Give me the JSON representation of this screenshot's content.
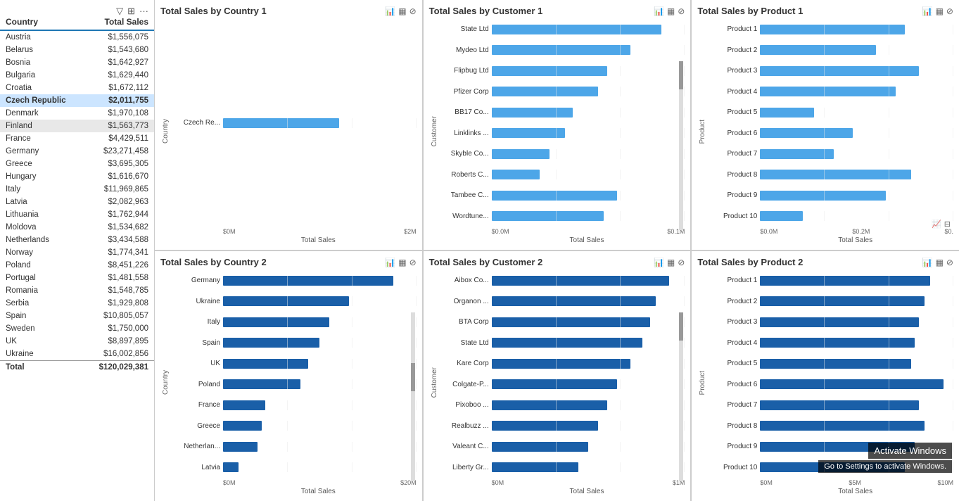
{
  "leftPanel": {
    "toolbar": [
      "filter-icon",
      "expand-icon",
      "more-icon"
    ],
    "columns": [
      "Country",
      "Total Sales"
    ],
    "rows": [
      {
        "country": "Austria",
        "sales": "$1,556,075",
        "highlight": false
      },
      {
        "country": "Belarus",
        "sales": "$1,543,680",
        "highlight": false
      },
      {
        "country": "Bosnia",
        "sales": "$1,642,927",
        "highlight": false
      },
      {
        "country": "Bulgaria",
        "sales": "$1,629,440",
        "highlight": false
      },
      {
        "country": "Croatia",
        "sales": "$1,672,112",
        "highlight": false
      },
      {
        "country": "Czech Republic",
        "sales": "$2,011,755",
        "highlight": true
      },
      {
        "country": "Denmark",
        "sales": "$1,970,108",
        "highlight": false
      },
      {
        "country": "Finland",
        "sales": "$1,563,773",
        "highlight": "light"
      },
      {
        "country": "France",
        "sales": "$4,429,511",
        "highlight": false
      },
      {
        "country": "Germany",
        "sales": "$23,271,458",
        "highlight": false
      },
      {
        "country": "Greece",
        "sales": "$3,695,305",
        "highlight": false
      },
      {
        "country": "Hungary",
        "sales": "$1,616,670",
        "highlight": false
      },
      {
        "country": "Italy",
        "sales": "$11,969,865",
        "highlight": false
      },
      {
        "country": "Latvia",
        "sales": "$2,082,963",
        "highlight": false
      },
      {
        "country": "Lithuania",
        "sales": "$1,762,944",
        "highlight": false
      },
      {
        "country": "Moldova",
        "sales": "$1,534,682",
        "highlight": false
      },
      {
        "country": "Netherlands",
        "sales": "$3,434,588",
        "highlight": false
      },
      {
        "country": "Norway",
        "sales": "$1,774,341",
        "highlight": false
      },
      {
        "country": "Poland",
        "sales": "$8,451,226",
        "highlight": false
      },
      {
        "country": "Portugal",
        "sales": "$1,481,558",
        "highlight": false
      },
      {
        "country": "Romania",
        "sales": "$1,548,785",
        "highlight": false
      },
      {
        "country": "Serbia",
        "sales": "$1,929,808",
        "highlight": false
      },
      {
        "country": "Spain",
        "sales": "$10,805,057",
        "highlight": false
      },
      {
        "country": "Sweden",
        "sales": "$1,750,000",
        "highlight": false
      },
      {
        "country": "UK",
        "sales": "$8,897,895",
        "highlight": false
      },
      {
        "country": "Ukraine",
        "sales": "$16,002,856",
        "highlight": false
      },
      {
        "country": "Total",
        "sales": "$120,029,381",
        "total": true
      }
    ]
  },
  "charts": {
    "topLeft": {
      "title": "Total Sales by Country 1",
      "yLabel": "Country",
      "xLabel": "Total Sales",
      "xTicks": [
        "$0M",
        "$2M"
      ],
      "bars": [
        {
          "label": "Czech Re...",
          "pct": 60,
          "dark": false
        }
      ]
    },
    "topMiddle": {
      "title": "Total Sales by Customer 1",
      "yLabel": "Customer",
      "xLabel": "Total Sales",
      "xTicks": [
        "$0.0M",
        "$0.1M"
      ],
      "bars": [
        {
          "label": "State Ltd",
          "pct": 88
        },
        {
          "label": "Mydeo Ltd",
          "pct": 72
        },
        {
          "label": "Flipbug Ltd",
          "pct": 60
        },
        {
          "label": "Pfizer Corp",
          "pct": 55
        },
        {
          "label": "BB17 Co...",
          "pct": 42
        },
        {
          "label": "Linklinks ...",
          "pct": 38
        },
        {
          "label": "Skyble Co...",
          "pct": 30
        },
        {
          "label": "Roberts C...",
          "pct": 25
        },
        {
          "label": "Tambee C...",
          "pct": 65
        },
        {
          "label": "Wordtune...",
          "pct": 58
        }
      ]
    },
    "topRight": {
      "title": "Total Sales by Product 1",
      "yLabel": "Product",
      "xLabel": "Total Sales",
      "xTicks": [
        "$0.0M",
        "$0.2M",
        "$0."
      ],
      "bars": [
        {
          "label": "Product 1",
          "pct": 75
        },
        {
          "label": "Product 2",
          "pct": 60
        },
        {
          "label": "Product 3",
          "pct": 82
        },
        {
          "label": "Product 4",
          "pct": 70
        },
        {
          "label": "Product 5",
          "pct": 28
        },
        {
          "label": "Product 6",
          "pct": 48
        },
        {
          "label": "Product 7",
          "pct": 38
        },
        {
          "label": "Product 8",
          "pct": 78
        },
        {
          "label": "Product 9",
          "pct": 65
        },
        {
          "label": "Product 10",
          "pct": 22
        }
      ]
    },
    "bottomLeft": {
      "title": "Total Sales by Country 2",
      "yLabel": "Country",
      "xLabel": "Total Sales",
      "xTicks": [
        "$0M",
        "$20M"
      ],
      "bars": [
        {
          "label": "Germany",
          "pct": 88
        },
        {
          "label": "Ukraine",
          "pct": 65
        },
        {
          "label": "Italy",
          "pct": 55
        },
        {
          "label": "Spain",
          "pct": 50
        },
        {
          "label": "UK",
          "pct": 44
        },
        {
          "label": "Poland",
          "pct": 40
        },
        {
          "label": "France",
          "pct": 22
        },
        {
          "label": "Greece",
          "pct": 20
        },
        {
          "label": "Netherlan...",
          "pct": 18
        },
        {
          "label": "Latvia",
          "pct": 8
        }
      ]
    },
    "bottomMiddle": {
      "title": "Total Sales by Customer 2",
      "yLabel": "Customer",
      "xLabel": "Total Sales",
      "xTicks": [
        "$0M",
        "$1M"
      ],
      "bars": [
        {
          "label": "Aibox Co...",
          "pct": 92
        },
        {
          "label": "Organon ...",
          "pct": 85
        },
        {
          "label": "BTA Corp",
          "pct": 82
        },
        {
          "label": "State Ltd",
          "pct": 78
        },
        {
          "label": "Kare Corp",
          "pct": 72
        },
        {
          "label": "Colgate-P...",
          "pct": 65
        },
        {
          "label": "Pixoboo ...",
          "pct": 60
        },
        {
          "label": "Realbuzz ...",
          "pct": 55
        },
        {
          "label": "Valeant C...",
          "pct": 50
        },
        {
          "label": "Liberty Gr...",
          "pct": 45
        }
      ]
    },
    "bottomRight": {
      "title": "Total Sales by Product 2",
      "yLabel": "Product",
      "xLabel": "Total Sales",
      "xTicks": [
        "$0M",
        "$5M",
        "$10M"
      ],
      "bars": [
        {
          "label": "Product 1",
          "pct": 88
        },
        {
          "label": "Product 2",
          "pct": 85
        },
        {
          "label": "Product 3",
          "pct": 82
        },
        {
          "label": "Product 4",
          "pct": 80
        },
        {
          "label": "Product 5",
          "pct": 78
        },
        {
          "label": "Product 6",
          "pct": 95
        },
        {
          "label": "Product 7",
          "pct": 82
        },
        {
          "label": "Product 8",
          "pct": 85
        },
        {
          "label": "Product 9",
          "pct": 80
        },
        {
          "label": "Product 10",
          "pct": 75
        }
      ]
    }
  },
  "windows": {
    "line1": "Activate Windows",
    "line2": "Go to Settings to activate Windows."
  }
}
